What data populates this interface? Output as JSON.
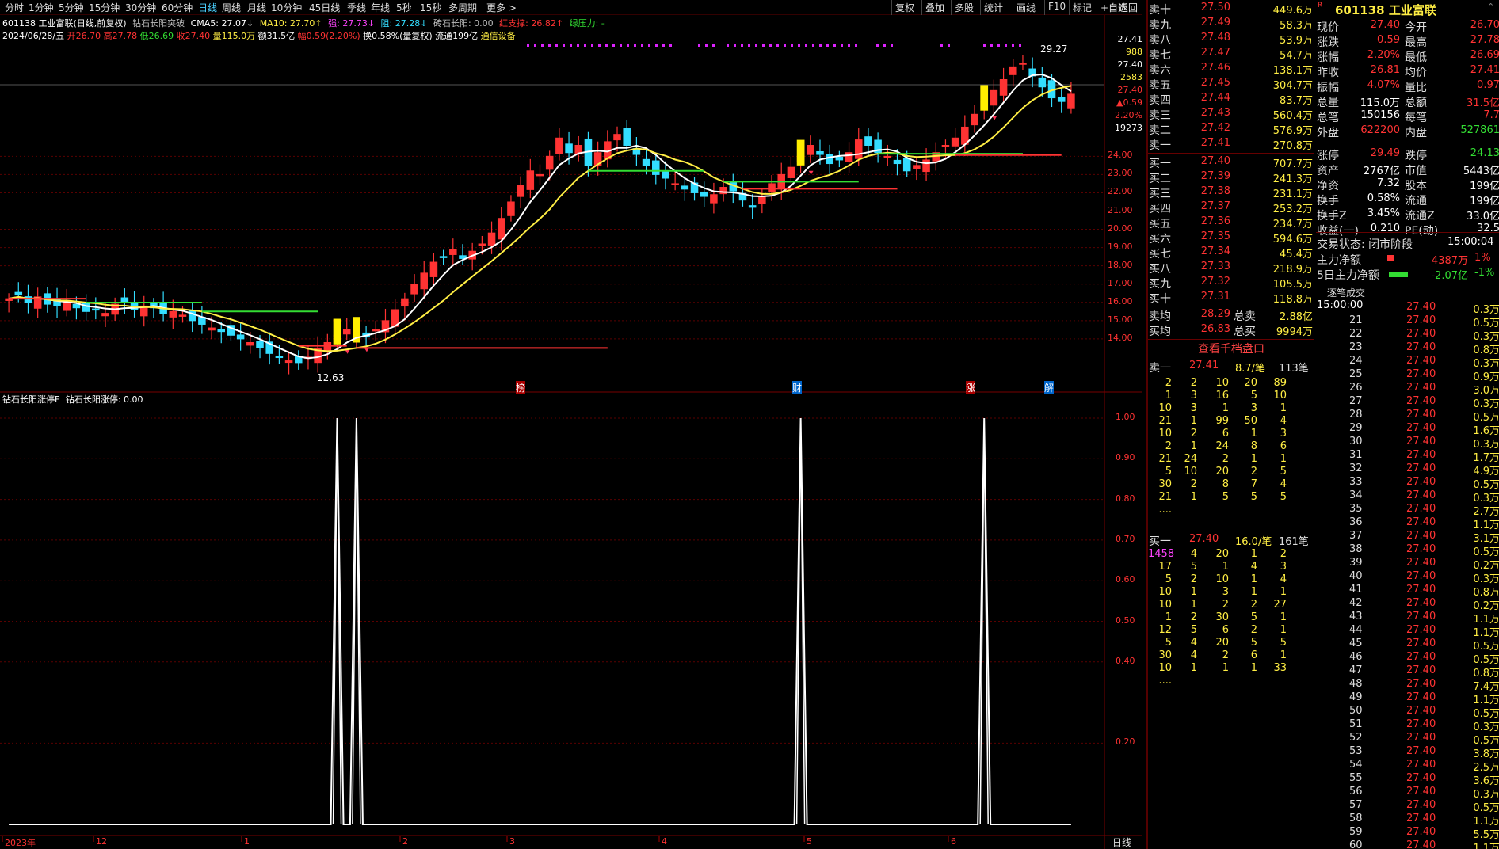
{
  "toolbar": {
    "tabs": [
      "分时",
      "1分钟",
      "5分钟",
      "15分钟",
      "30分钟",
      "60分钟",
      "日线",
      "周线",
      "月线",
      "10分钟",
      "45日线",
      "季线",
      "年线",
      "5秒",
      "15秒",
      "多周期",
      "更多 >"
    ],
    "active_index": 6,
    "right": [
      "复权",
      "叠加",
      "多股",
      "统计",
      "画线",
      "F10",
      "标记",
      "+自选",
      "返回"
    ]
  },
  "header": {
    "stock": "601138 工业富联(日线,前复权)",
    "indicator": "钻石长阳突破",
    "cma5": "CMA5: 27.07↓",
    "ma10": "MA10: 27.70↑",
    "strong": "强: 27.73↓",
    "resist": "阻: 27.28↓",
    "diamond": "砖石长阳: 0.00",
    "red_support": "红支撑: 26.82↑",
    "green_press": "绿压力: -",
    "date": "2024/06/28/五",
    "open": "开26.70",
    "high": "高27.78",
    "low": "低26.69",
    "close": "收27.40",
    "vol": "量115.0万",
    "amount": "额31.5亿",
    "amp": "幅0.59(2.20%)",
    "turnover": "换0.58%(量复权)",
    "float": "流通199亿",
    "sector": "通信设备"
  },
  "sub_indicator": {
    "title": "钻石长阳涨停F",
    "value": "钻石长阳涨停: 0.00"
  },
  "price_axis": {
    "top_labels": [
      "27.41",
      "988",
      "27.40",
      "2583",
      "27.40",
      "▲0.59",
      "2.20%",
      "19273"
    ],
    "ticks": [
      "24.00",
      "23.00",
      "22.00",
      "21.00",
      "20.00",
      "19.00",
      "18.00",
      "17.00",
      "16.00",
      "15.00",
      "14.00"
    ]
  },
  "sub_axis": {
    "ticks": [
      "1.00",
      "0.90",
      "0.80",
      "0.70",
      "0.60",
      "0.50",
      "0.40",
      "0.20"
    ]
  },
  "date_axis": {
    "labels": [
      "2023年",
      "12",
      "1",
      "2",
      "3",
      "4",
      "5",
      "6"
    ],
    "period": "日线"
  },
  "chart_labels": {
    "high": "29.27",
    "low": "12.63",
    "mark1": "榜",
    "mark2": "财",
    "mark3": "涨",
    "mark4": "解"
  },
  "chart_data": {
    "type": "candlestick",
    "ylim": [
      12,
      30
    ],
    "closes": [
      16.2,
      16.4,
      16.0,
      16.3,
      15.9,
      15.8,
      16.1,
      15.7,
      15.5,
      15.6,
      15.4,
      15.9,
      16.0,
      15.6,
      15.8,
      15.7,
      15.4,
      15.5,
      15.3,
      15.0,
      14.8,
      14.6,
      14.4,
      14.2,
      14.0,
      13.8,
      13.5,
      13.2,
      13.0,
      12.8,
      12.7,
      13.0,
      13.5,
      13.8,
      14.2,
      14.5,
      14.3,
      14.1,
      14.5,
      15.0,
      15.6,
      16.2,
      17.0,
      17.6,
      18.2,
      18.5,
      18.9,
      18.4,
      18.8,
      19.2,
      19.8,
      20.6,
      21.5,
      22.4,
      23.2,
      23.0,
      24.0,
      25.0,
      24.2,
      24.6,
      23.5,
      24.2,
      24.8,
      25.2,
      24.6,
      24.1,
      23.5,
      23.0,
      22.8,
      22.5,
      22.2,
      22.0,
      21.8,
      21.9,
      22.3,
      22.1,
      21.6,
      21.2,
      21.8,
      22.5,
      23.0,
      23.4,
      24.0,
      24.6,
      24.1,
      23.6,
      23.8,
      24.2,
      24.9,
      24.6,
      24.2,
      24.0,
      23.6,
      23.2,
      23.5,
      23.8,
      24.2,
      24.6,
      25.0,
      25.6,
      26.3,
      27.0,
      27.6,
      28.2,
      28.9,
      29.1,
      28.4,
      27.8,
      27.2,
      27.0,
      27.4
    ],
    "ma_white": "MA5",
    "ma_yellow": "MA10",
    "sub_series": {
      "name": "钻石长阳涨停",
      "peaks_at_index": [
        34,
        36,
        82,
        101
      ],
      "value": 1.0
    }
  },
  "orderbook": {
    "asks": [
      {
        "l": "卖十",
        "p": "27.50",
        "v": "449.6万"
      },
      {
        "l": "卖九",
        "p": "27.49",
        "v": "58.3万"
      },
      {
        "l": "卖八",
        "p": "27.48",
        "v": "53.9万"
      },
      {
        "l": "卖七",
        "p": "27.47",
        "v": "54.7万"
      },
      {
        "l": "卖六",
        "p": "27.46",
        "v": "138.1万"
      },
      {
        "l": "卖五",
        "p": "27.45",
        "v": "304.7万"
      },
      {
        "l": "卖四",
        "p": "27.44",
        "v": "83.7万"
      },
      {
        "l": "卖三",
        "p": "27.43",
        "v": "560.4万"
      },
      {
        "l": "卖二",
        "p": "27.42",
        "v": "576.9万"
      },
      {
        "l": "卖一",
        "p": "27.41",
        "v": "270.8万"
      }
    ],
    "bids": [
      {
        "l": "买一",
        "p": "27.40",
        "v": "707.7万"
      },
      {
        "l": "买二",
        "p": "27.39",
        "v": "241.3万"
      },
      {
        "l": "买三",
        "p": "27.38",
        "v": "231.1万"
      },
      {
        "l": "买四",
        "p": "27.37",
        "v": "253.2万"
      },
      {
        "l": "买五",
        "p": "27.36",
        "v": "234.7万"
      },
      {
        "l": "买六",
        "p": "27.35",
        "v": "594.6万"
      },
      {
        "l": "买七",
        "p": "27.34",
        "v": "45.4万"
      },
      {
        "l": "买八",
        "p": "27.33",
        "v": "218.9万"
      },
      {
        "l": "买九",
        "p": "27.32",
        "v": "105.5万"
      },
      {
        "l": "买十",
        "p": "27.31",
        "v": "118.8万"
      }
    ],
    "avg_sell_l": "卖均",
    "avg_sell": "28.29",
    "tot_sell_l": "总卖",
    "tot_sell": "2.88亿",
    "avg_buy_l": "买均",
    "avg_buy": "26.83",
    "tot_buy_l": "总买",
    "tot_buy": "9994万",
    "view_link": "查看千档盘口",
    "sell1": {
      "l": "卖一",
      "p": "27.41",
      "per": "8.7/笔",
      "cnt": "113笔"
    },
    "buy1": {
      "l": "买一",
      "p": "27.40",
      "per": "16.0/笔",
      "cnt": "161笔"
    },
    "sell_queue": [
      [
        "2",
        "2",
        "10",
        "20",
        "89"
      ],
      [
        "1",
        "3",
        "16",
        "5",
        "10"
      ],
      [
        "10",
        "3",
        "1",
        "3",
        "1"
      ],
      [
        "21",
        "1",
        "99",
        "50",
        "4"
      ],
      [
        "10",
        "2",
        "6",
        "1",
        "3"
      ],
      [
        "2",
        "1",
        "24",
        "8",
        "6"
      ],
      [
        "21",
        "24",
        "2",
        "1",
        "1"
      ],
      [
        "5",
        "10",
        "20",
        "2",
        "5"
      ],
      [
        "30",
        "2",
        "8",
        "7",
        "4"
      ],
      [
        "21",
        "1",
        "5",
        "5",
        "5"
      ],
      [
        "....",
        "",
        "",
        "",
        ""
      ]
    ],
    "buy_queue": [
      [
        "1458",
        "4",
        "20",
        "1",
        "2"
      ],
      [
        "17",
        "5",
        "1",
        "4",
        "3"
      ],
      [
        "5",
        "2",
        "10",
        "1",
        "4"
      ],
      [
        "10",
        "1",
        "3",
        "1",
        "1"
      ],
      [
        "10",
        "1",
        "2",
        "2",
        "27"
      ],
      [
        "1",
        "2",
        "30",
        "5",
        "1"
      ],
      [
        "12",
        "5",
        "6",
        "2",
        "1"
      ],
      [
        "5",
        "4",
        "20",
        "5",
        "5"
      ],
      [
        "30",
        "4",
        "2",
        "6",
        "1"
      ],
      [
        "10",
        "1",
        "1",
        "1",
        "33"
      ],
      [
        "....",
        "",
        "",
        "",
        ""
      ]
    ]
  },
  "quote": {
    "title": "601138 工业富联",
    "rows": [
      [
        "现价",
        "27.40",
        "今开",
        "26.70"
      ],
      [
        "涨跌",
        "0.59",
        "最高",
        "27.78"
      ],
      [
        "涨幅",
        "2.20%",
        "最低",
        "26.69"
      ],
      [
        "昨收",
        "26.81",
        "均价",
        "27.41"
      ],
      [
        "振幅",
        "4.07%",
        "量比",
        "0.97"
      ],
      [
        "总量",
        "115.0万",
        "总额",
        "31.5亿"
      ],
      [
        "总笔",
        "150156",
        "每笔",
        "7.7"
      ],
      [
        "外盘",
        "622200",
        "内盘",
        "527861"
      ],
      [
        "涨停",
        "29.49",
        "跌停",
        "24.13"
      ],
      [
        "资产",
        "2767亿",
        "市值",
        "5443亿"
      ],
      [
        "净资",
        "7.32",
        "股本",
        "199亿"
      ],
      [
        "换手",
        "0.58%",
        "流通",
        "199亿"
      ],
      [
        "换手Z",
        "3.45%",
        "流通Z",
        "33.0亿"
      ],
      [
        "收益(一)",
        "0.210",
        "PE(动)",
        "32.5"
      ]
    ],
    "status": "交易状态: 闭市阶段",
    "status_time": "15:00:04",
    "main_flow": "主力净额",
    "main_flow_v": "4387万",
    "main_flow_p": "1%",
    "flow5": "5日主力净额",
    "flow5_v": "-2.07亿",
    "flow5_p": "-1%",
    "ticks_title": "逐笔成交",
    "ticks_time": "15:00:00"
  },
  "ticks": [
    [
      "",
      "27.40",
      "0.3万"
    ],
    [
      "21",
      "27.40",
      "0.5万"
    ],
    [
      "22",
      "27.40",
      "0.3万"
    ],
    [
      "23",
      "27.40",
      "0.8万"
    ],
    [
      "24",
      "27.40",
      "0.3万"
    ],
    [
      "25",
      "27.40",
      "0.9万"
    ],
    [
      "26",
      "27.40",
      "3.0万"
    ],
    [
      "27",
      "27.40",
      "0.3万"
    ],
    [
      "28",
      "27.40",
      "0.5万"
    ],
    [
      "29",
      "27.40",
      "1.6万"
    ],
    [
      "30",
      "27.40",
      "0.3万"
    ],
    [
      "31",
      "27.40",
      "1.7万"
    ],
    [
      "32",
      "27.40",
      "4.9万"
    ],
    [
      "33",
      "27.40",
      "0.5万"
    ],
    [
      "34",
      "27.40",
      "0.3万"
    ],
    [
      "35",
      "27.40",
      "2.7万"
    ],
    [
      "36",
      "27.40",
      "1.1万"
    ],
    [
      "37",
      "27.40",
      "3.1万"
    ],
    [
      "38",
      "27.40",
      "0.5万"
    ],
    [
      "39",
      "27.40",
      "0.2万"
    ],
    [
      "40",
      "27.40",
      "0.3万"
    ],
    [
      "41",
      "27.40",
      "0.8万"
    ],
    [
      "42",
      "27.40",
      "0.2万"
    ],
    [
      "43",
      "27.40",
      "1.1万"
    ],
    [
      "44",
      "27.40",
      "1.1万"
    ],
    [
      "45",
      "27.40",
      "0.5万"
    ],
    [
      "46",
      "27.40",
      "0.5万"
    ],
    [
      "47",
      "27.40",
      "0.8万"
    ],
    [
      "48",
      "27.40",
      "7.4万"
    ],
    [
      "49",
      "27.40",
      "1.1万"
    ],
    [
      "50",
      "27.40",
      "0.5万"
    ],
    [
      "51",
      "27.40",
      "0.3万"
    ],
    [
      "52",
      "27.40",
      "0.5万"
    ],
    [
      "53",
      "27.40",
      "3.8万"
    ],
    [
      "54",
      "27.40",
      "2.5万"
    ],
    [
      "55",
      "27.40",
      "3.6万"
    ],
    [
      "56",
      "27.40",
      "0.3万"
    ],
    [
      "57",
      "27.40",
      "0.5万"
    ],
    [
      "58",
      "27.40",
      "1.1万"
    ],
    [
      "59",
      "27.40",
      "5.5万"
    ],
    [
      "60",
      "27.40",
      "1.1万"
    ]
  ],
  "colors": {
    "up": "#ff3333",
    "down": "#33ddff",
    "ma5": "#ffffff",
    "ma10": "#ffee44",
    "grid": "#5a0000"
  }
}
